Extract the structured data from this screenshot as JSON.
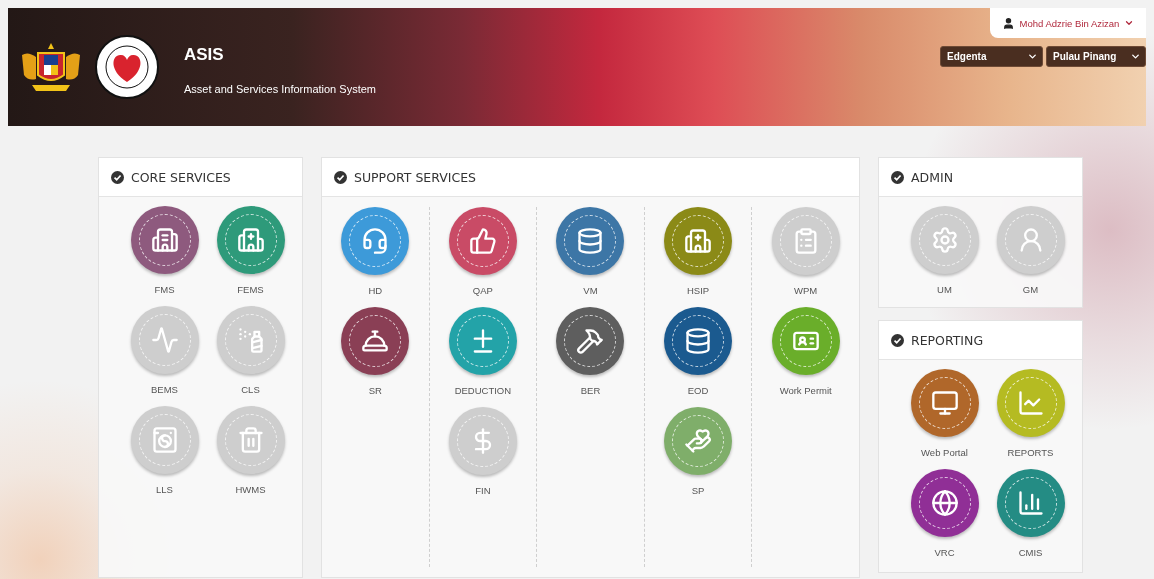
{
  "header": {
    "title": "ASIS",
    "subtitle": "Asset and Services Information System",
    "user": {
      "name": "Mohd Adzrie Bin Azizan"
    },
    "selects": [
      {
        "value": "Edgenta"
      },
      {
        "value": "Pulau Pinang"
      }
    ]
  },
  "sections": [
    {
      "kind": "grid",
      "title": "CORE SERVICES",
      "modules": [
        {
          "label": "FMS",
          "color": "#8e5a7e"
        },
        {
          "label": "FEMS",
          "color": "#2e9a7a"
        },
        {
          "label": "BEMS",
          "color": "#cecece"
        },
        {
          "label": "CLS",
          "color": "#cecece"
        },
        {
          "label": "LLS",
          "color": "#cecece"
        },
        {
          "label": "HWMS",
          "color": "#cecece"
        }
      ]
    },
    {
      "kind": "columns",
      "title": "SUPPORT SERVICES",
      "columns": [
        {
          "modules": [
            {
              "label": "HD",
              "color": "#3d9ad9"
            },
            {
              "label": "SR",
              "color": "#8a3f55"
            }
          ]
        },
        {
          "modules": [
            {
              "label": "QAP",
              "color": "#c94b66"
            },
            {
              "label": "DEDUCTION",
              "color": "#23a3a8"
            },
            {
              "label": "FIN",
              "color": "#cecece"
            }
          ]
        },
        {
          "modules": [
            {
              "label": "VM",
              "color": "#3d76a6"
            },
            {
              "label": "BER",
              "color": "#5e5e5e"
            }
          ]
        },
        {
          "modules": [
            {
              "label": "HSIP",
              "color": "#8b8a17"
            },
            {
              "label": "EOD",
              "color": "#1b5a8f"
            },
            {
              "label": "SP",
              "color": "#7fae6a"
            }
          ]
        },
        {
          "modules": [
            {
              "label": "WPM",
              "color": "#cecece"
            },
            {
              "label": "Work Permit",
              "color": "#6aae2a"
            }
          ]
        }
      ]
    },
    {
      "kind": "grid",
      "title": "ADMIN",
      "modules": [
        {
          "label": "UM",
          "color": "#cecece"
        },
        {
          "label": "GM",
          "color": "#cecece"
        }
      ]
    },
    {
      "kind": "grid",
      "title": "REPORTING",
      "modules": [
        {
          "label": "Web Portal",
          "color": "#b0672a"
        },
        {
          "label": "REPORTS",
          "color": "#b5bb22"
        },
        {
          "label": "VRC",
          "color": "#902f96"
        },
        {
          "label": "CMIS",
          "color": "#248c84"
        }
      ]
    }
  ]
}
